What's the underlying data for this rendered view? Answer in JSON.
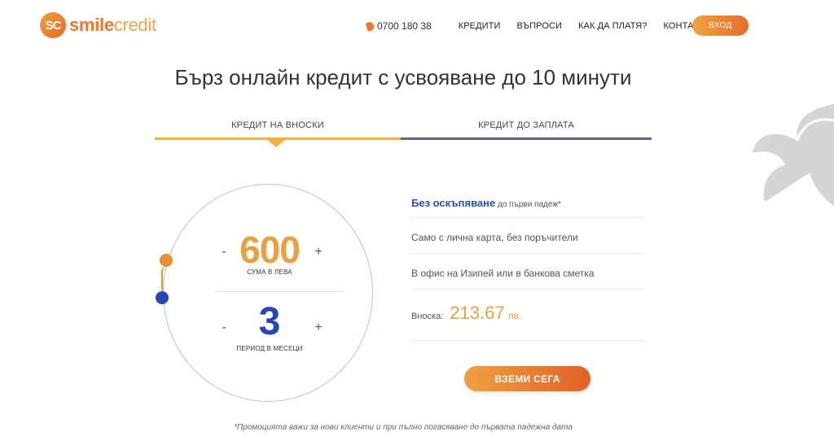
{
  "logo": {
    "mark": "SC",
    "smile": "smile",
    "credit": "credit"
  },
  "header": {
    "phone": "0700 180 38",
    "nav": [
      "КРЕДИТИ",
      "ВЪПРОСИ",
      "КАК ДА ПЛАТЯ?",
      "КОНТАКТИ"
    ],
    "login_label": "ВХОД"
  },
  "title": "Бърз онлайн кредит с усвояване до 10 минути",
  "tabs": [
    {
      "label": "КРЕДИТ НА ВНОСКИ",
      "active": true
    },
    {
      "label": "КРЕДИТ ДО ЗАПЛАТА",
      "active": false
    }
  ],
  "calculator": {
    "amount": "600",
    "amount_label": "СУМА В ЛЕВА",
    "period": "3",
    "period_label": "ПЕРИОД В МЕСЕЦИ",
    "minus": "-",
    "plus": "+"
  },
  "info": {
    "row1_highlight": "Без оскъпяване",
    "row1_rest": " до първи падеж*",
    "row2": "Само с лична карта, без поръчители",
    "row3": "В офис на Изипей или в банкова сметка",
    "installment_label": "Вноска:",
    "installment_value": "213.67",
    "installment_unit": "лв."
  },
  "cta_label": "ВЗЕМИ СЕГА",
  "footnote": "*Промоцията важи за нови клиенти и при пълно погасяване до първата падежна дата",
  "colors": {
    "accent": "#e9a040",
    "brand_orange": "#e9792e",
    "blue": "#2446b8"
  }
}
